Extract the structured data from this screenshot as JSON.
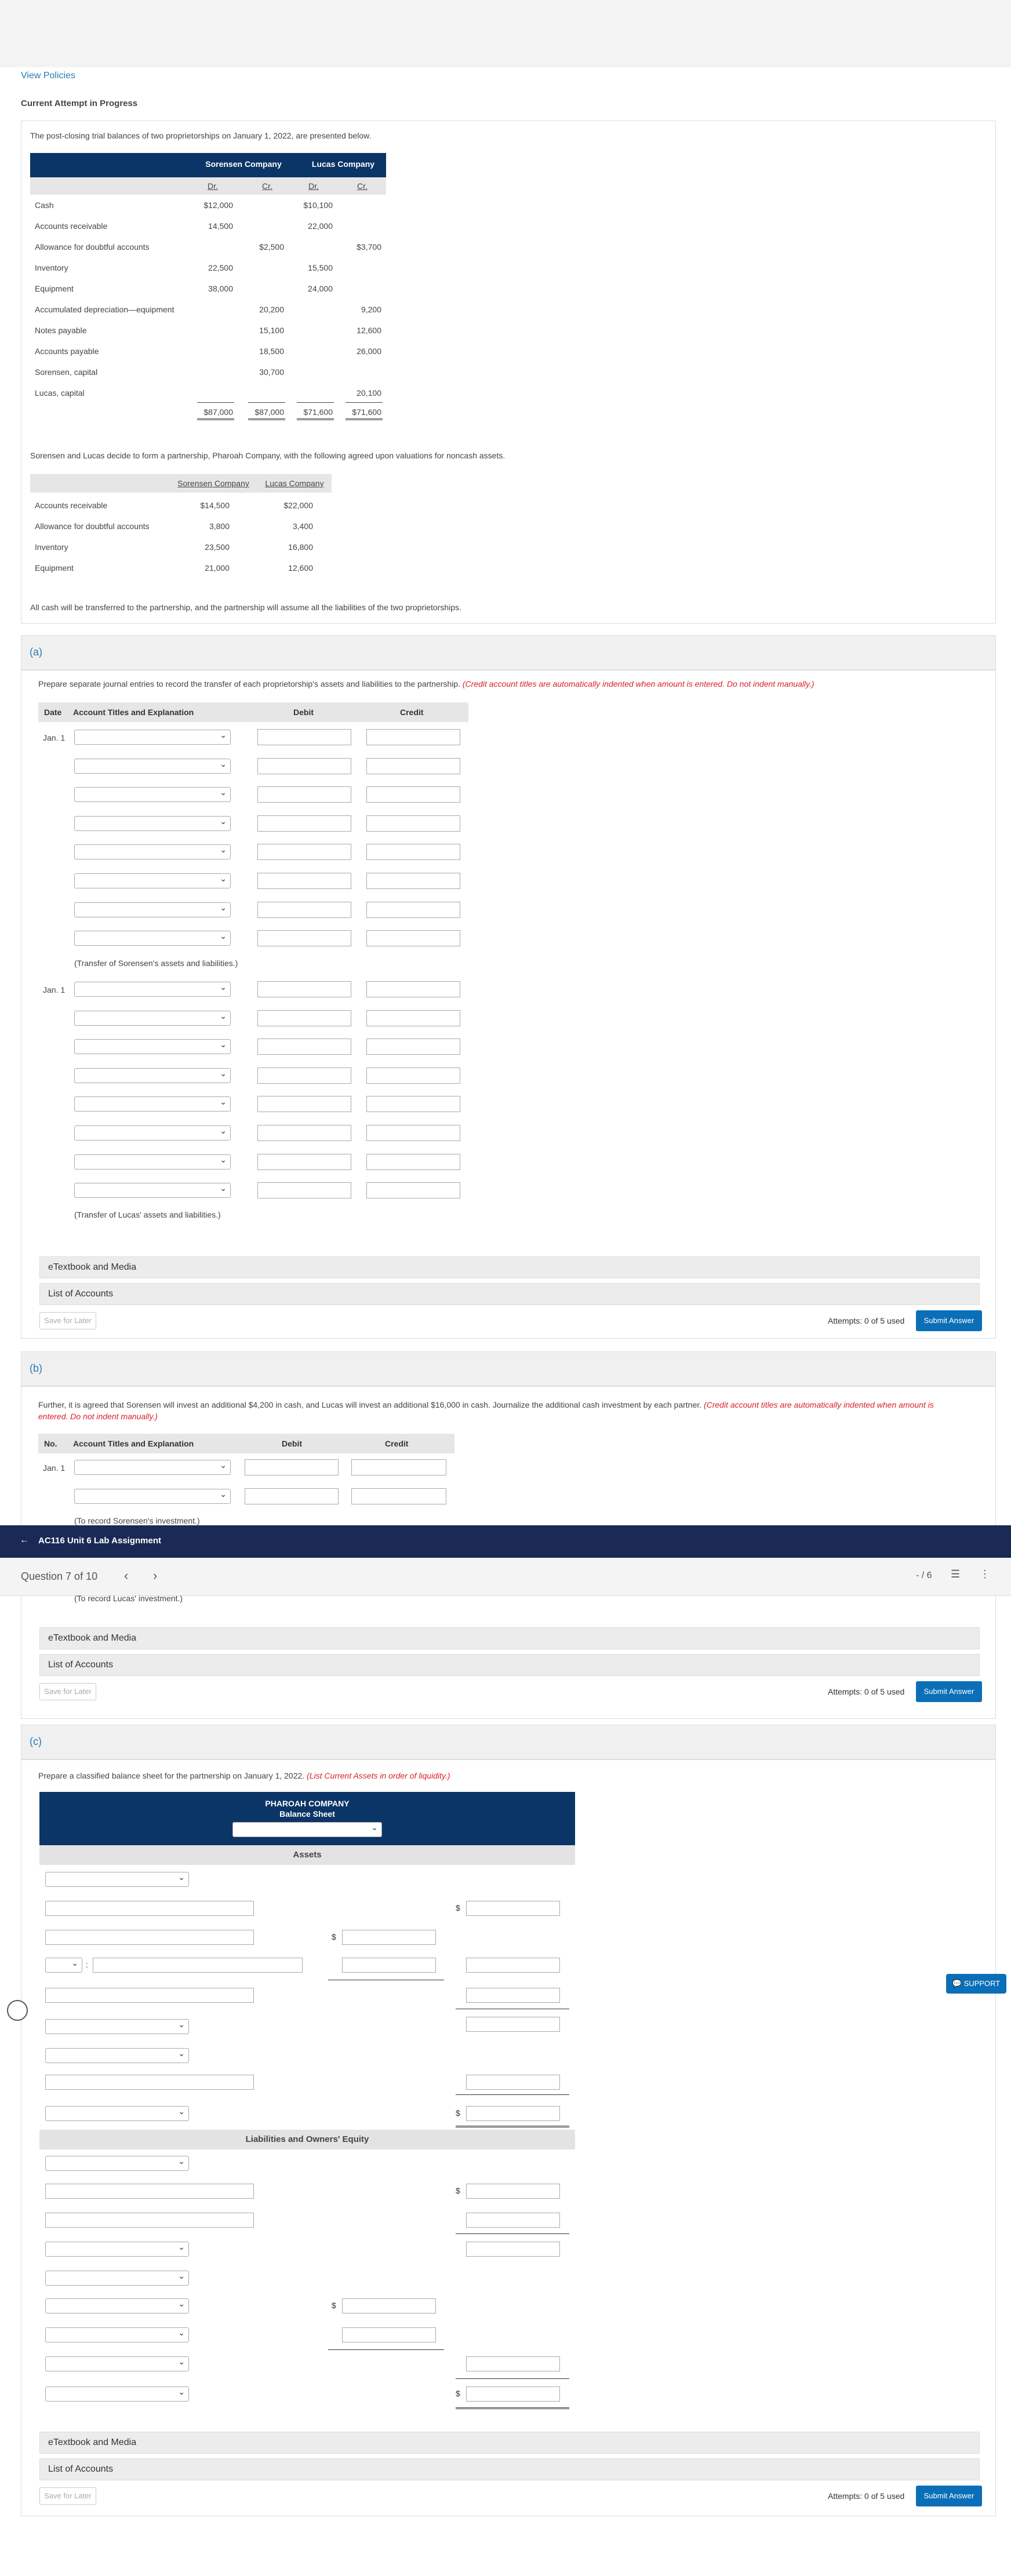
{
  "link_view_policies": "View Policies",
  "current_attempt": "Current Attempt in Progress",
  "intro": "The post-closing trial balances of two proprietorships on January 1, 2022, are presented below.",
  "tb": {
    "company1": "Sorensen Company",
    "company2": "Lucas Company",
    "dr": "Dr.",
    "cr": "Cr.",
    "rows": [
      {
        "label": "Cash",
        "c1dr": "$12,000",
        "c1cr": "",
        "c2dr": "$10,100",
        "c2cr": ""
      },
      {
        "label": "Accounts receivable",
        "c1dr": "14,500",
        "c1cr": "",
        "c2dr": "22,000",
        "c2cr": ""
      },
      {
        "label": "Allowance for doubtful accounts",
        "c1dr": "",
        "c1cr": "$2,500",
        "c2dr": "",
        "c2cr": "$3,700"
      },
      {
        "label": "Inventory",
        "c1dr": "22,500",
        "c1cr": "",
        "c2dr": "15,500",
        "c2cr": ""
      },
      {
        "label": "Equipment",
        "c1dr": "38,000",
        "c1cr": "",
        "c2dr": "24,000",
        "c2cr": ""
      },
      {
        "label": "Accumulated depreciation—equipment",
        "c1dr": "",
        "c1cr": "20,200",
        "c2dr": "",
        "c2cr": "9,200"
      },
      {
        "label": "Notes payable",
        "c1dr": "",
        "c1cr": "15,100",
        "c2dr": "",
        "c2cr": "12,600"
      },
      {
        "label": "Accounts payable",
        "c1dr": "",
        "c1cr": "18,500",
        "c2dr": "",
        "c2cr": "26,000"
      },
      {
        "label": "Sorensen, capital",
        "c1dr": "",
        "c1cr": "30,700",
        "c2dr": "",
        "c2cr": ""
      },
      {
        "label": "Lucas, capital",
        "c1dr": "",
        "c1cr": "",
        "c2dr": "",
        "c2cr": "20,100"
      }
    ],
    "totals": {
      "c1dr": "$87,000",
      "c1cr": "$87,000",
      "c2dr": "$71,600",
      "c2cr": "$71,600"
    }
  },
  "para2": "Sorensen and Lucas decide to form a partnership, Pharoah Company, with the following agreed upon valuations for noncash assets.",
  "val": {
    "col1": "Sorensen Company",
    "col2": "Lucas Company",
    "rows": [
      {
        "label": "Accounts receivable",
        "v1": "$14,500",
        "v2": "$22,000"
      },
      {
        "label": "Allowance for doubtful accounts",
        "v1": "3,800",
        "v2": "3,400"
      },
      {
        "label": "Inventory",
        "v1": "23,500",
        "v2": "16,800"
      },
      {
        "label": "Equipment",
        "v1": "21,000",
        "v2": "12,600"
      }
    ]
  },
  "para3": "All cash will be transferred to the partnership, and the partnership will assume all the liabilities of the two proprietorships.",
  "partA": {
    "label": "(a)",
    "instruction": "Prepare separate journal entries to record the transfer of each proprietorship's assets and liabilities to the partnership.",
    "instruction_red": "(Credit account titles are automatically indented when amount is entered. Do not indent manually.)",
    "h_date": "Date",
    "h_acct": "Account Titles and Explanation",
    "h_debit": "Debit",
    "h_credit": "Credit",
    "date1": "Jan. 1",
    "note1": "(Transfer of Sorensen's assets and liabilities.)",
    "date2": "Jan. 1",
    "note2": "(Transfer of Lucas' assets and liabilities.)"
  },
  "partB": {
    "label": "(b)",
    "instruction": "Further, it is agreed that Sorensen will invest an additional $4,200 in cash, and Lucas will invest an additional $16,000 in cash. Journalize the additional cash investment by each partner.",
    "instruction_red": "(Credit account titles are automatically indented when amount is entered. Do not indent manually.)",
    "h_no": "No.",
    "h_acct": "Account Titles and Explanation",
    "h_debit": "Debit",
    "h_credit": "Credit",
    "date1": "Jan. 1",
    "note1": "(To record Sorensen's investment.)",
    "note2": "(To record Lucas' investment.)"
  },
  "partC": {
    "label": "(c)",
    "instruction": "Prepare a classified balance sheet for the partnership on January 1, 2022.",
    "instruction_red": "(List Current Assets in order of liquidity.)",
    "company": "PHAROAH COMPANY",
    "statement": "Balance Sheet",
    "assets": "Assets",
    "liab": "Liabilities and Owners' Equity",
    "colon": ":"
  },
  "footer": {
    "etext": "eTextbook and Media",
    "accounts": "List of Accounts",
    "save": "Save for Later",
    "attempts": "Attempts: 0 of 5 used",
    "submit": "Submit Answer"
  },
  "nav": {
    "back_title": "AC116 Unit 6 Lab Assignment",
    "question": "Question 7 of 10",
    "prev": "‹",
    "next": "›",
    "score": "- / 6"
  },
  "support": "SUPPORT",
  "currency": "$"
}
